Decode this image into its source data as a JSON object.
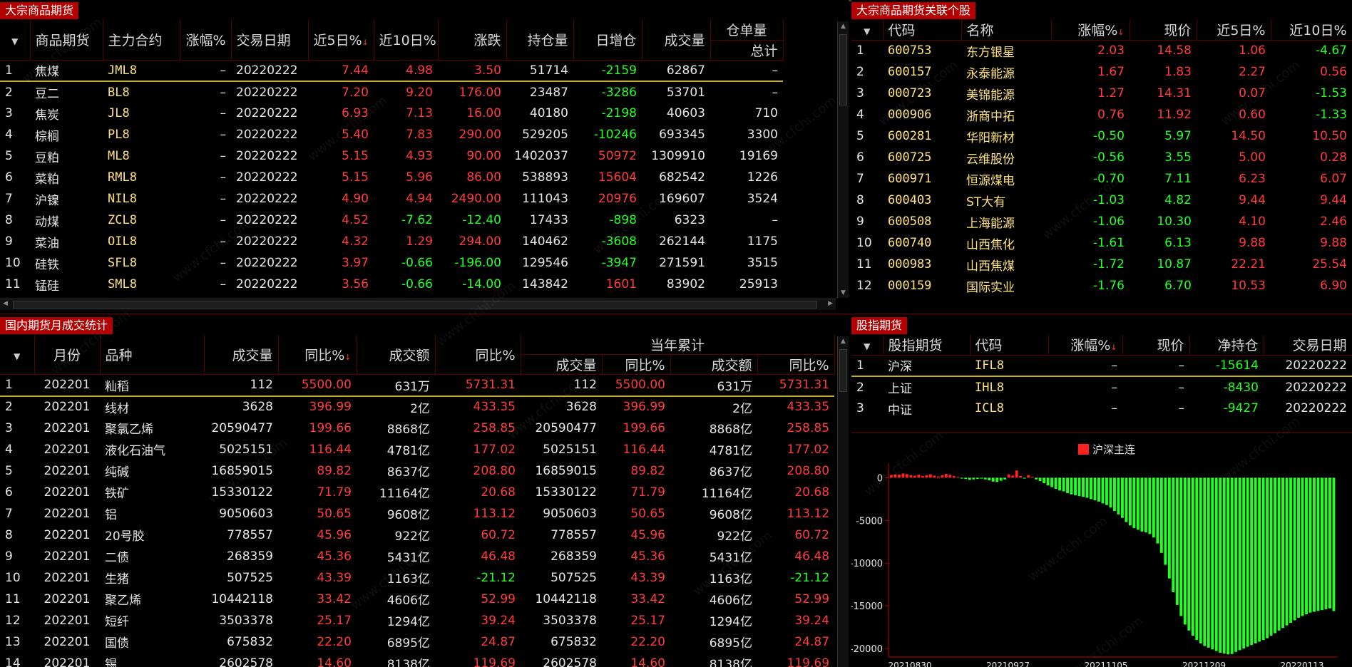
{
  "futures": {
    "title": "大宗商品期货",
    "columns": [
      "",
      "商品期货",
      "主力合约",
      "涨幅%",
      "交易日期",
      "近5日%",
      "近10日%",
      "涨跌",
      "持仓量",
      "日增仓",
      "成交量",
      "仓单量"
    ],
    "col_sub": "总计",
    "rows": [
      {
        "n": "1",
        "name": "焦煤",
        "code": "JML8",
        "chg": "–",
        "date": "20220222",
        "d5": "7.44",
        "d10": "4.98",
        "ud": "3.50",
        "oi": "51714",
        "inc": "-2159",
        "vol": "62867",
        "wr": "–"
      },
      {
        "n": "2",
        "name": "豆二",
        "code": "BL8",
        "chg": "–",
        "date": "20220222",
        "d5": "7.20",
        "d10": "9.20",
        "ud": "176.00",
        "oi": "23487",
        "inc": "-3286",
        "vol": "53701",
        "wr": "–"
      },
      {
        "n": "3",
        "name": "焦炭",
        "code": "JL8",
        "chg": "–",
        "date": "20220222",
        "d5": "6.93",
        "d10": "7.13",
        "ud": "16.00",
        "oi": "40180",
        "inc": "-2198",
        "vol": "40603",
        "wr": "710"
      },
      {
        "n": "4",
        "name": "棕榈",
        "code": "PL8",
        "chg": "–",
        "date": "20220222",
        "d5": "5.40",
        "d10": "7.83",
        "ud": "290.00",
        "oi": "529205",
        "inc": "-10246",
        "vol": "693345",
        "wr": "3300"
      },
      {
        "n": "5",
        "name": "豆粕",
        "code": "ML8",
        "chg": "–",
        "date": "20220222",
        "d5": "5.15",
        "d10": "4.93",
        "ud": "90.00",
        "oi": "1402037",
        "inc": "50972",
        "vol": "1309910",
        "wr": "19169"
      },
      {
        "n": "6",
        "name": "菜粕",
        "code": "RML8",
        "chg": "–",
        "date": "20220222",
        "d5": "5.15",
        "d10": "5.96",
        "ud": "86.00",
        "oi": "538893",
        "inc": "15604",
        "vol": "682542",
        "wr": "1226"
      },
      {
        "n": "7",
        "name": "沪镍",
        "code": "NIL8",
        "chg": "–",
        "date": "20220222",
        "d5": "4.90",
        "d10": "4.94",
        "ud": "2490.00",
        "oi": "111043",
        "inc": "20976",
        "vol": "169607",
        "wr": "3524"
      },
      {
        "n": "8",
        "name": "动煤",
        "code": "ZCL8",
        "chg": "–",
        "date": "20220222",
        "d5": "4.52",
        "d10": "-7.62",
        "ud": "-12.40",
        "oi": "17433",
        "inc": "-898",
        "vol": "6323",
        "wr": "–"
      },
      {
        "n": "9",
        "name": "菜油",
        "code": "OIL8",
        "chg": "–",
        "date": "20220222",
        "d5": "4.32",
        "d10": "1.29",
        "ud": "294.00",
        "oi": "140462",
        "inc": "-3608",
        "vol": "262144",
        "wr": "1175"
      },
      {
        "n": "10",
        "name": "硅铁",
        "code": "SFL8",
        "chg": "–",
        "date": "20220222",
        "d5": "3.97",
        "d10": "-0.66",
        "ud": "-196.00",
        "oi": "129546",
        "inc": "-3947",
        "vol": "271591",
        "wr": "3515"
      },
      {
        "n": "11",
        "name": "锰硅",
        "code": "SML8",
        "chg": "–",
        "date": "20220222",
        "d5": "3.56",
        "d10": "-0.66",
        "ud": "-14.00",
        "oi": "143842",
        "inc": "1601",
        "vol": "83902",
        "wr": "25913"
      }
    ]
  },
  "stocks": {
    "title": "大宗商品期货关联个股",
    "columns": [
      "",
      "代码",
      "名称",
      "涨幅%",
      "现价",
      "近5日%",
      "近10日%"
    ],
    "rows": [
      {
        "n": "1",
        "code": "600753",
        "name": "东方银星",
        "chg": "2.03",
        "price": "14.58",
        "d5": "1.06",
        "d10": "-4.67"
      },
      {
        "n": "2",
        "code": "600157",
        "name": "永泰能源",
        "chg": "1.67",
        "price": "1.83",
        "d5": "2.27",
        "d10": "0.56"
      },
      {
        "n": "3",
        "code": "000723",
        "name": "美锦能源",
        "chg": "1.27",
        "price": "14.31",
        "d5": "0.07",
        "d10": "-1.53"
      },
      {
        "n": "4",
        "code": "000906",
        "name": "浙商中拓",
        "chg": "0.76",
        "price": "11.92",
        "d5": "0.60",
        "d10": "-1.33"
      },
      {
        "n": "5",
        "code": "600281",
        "name": "华阳新材",
        "chg": "-0.50",
        "price": "5.97",
        "d5": "14.50",
        "d10": "10.50"
      },
      {
        "n": "6",
        "code": "600725",
        "name": "云维股份",
        "chg": "-0.56",
        "price": "3.55",
        "d5": "5.00",
        "d10": "0.28"
      },
      {
        "n": "7",
        "code": "600971",
        "name": "恒源煤电",
        "chg": "-0.70",
        "price": "7.11",
        "d5": "6.23",
        "d10": "6.07"
      },
      {
        "n": "8",
        "code": "600403",
        "name": "ST大有",
        "chg": "-1.03",
        "price": "4.82",
        "d5": "9.44",
        "d10": "9.44"
      },
      {
        "n": "9",
        "code": "600508",
        "name": "上海能源",
        "chg": "-1.06",
        "price": "10.30",
        "d5": "4.10",
        "d10": "2.46"
      },
      {
        "n": "10",
        "code": "600740",
        "name": "山西焦化",
        "chg": "-1.61",
        "price": "6.13",
        "d5": "9.88",
        "d10": "9.88"
      },
      {
        "n": "11",
        "code": "000983",
        "name": "山西焦煤",
        "chg": "-1.72",
        "price": "10.87",
        "d5": "22.21",
        "d10": "25.54"
      },
      {
        "n": "12",
        "code": "000159",
        "name": "国际实业",
        "chg": "-1.76",
        "price": "6.70",
        "d5": "10.53",
        "d10": "6.90"
      }
    ]
  },
  "monthly": {
    "title": "国内期货月成交统计",
    "columns": [
      "",
      "月份",
      "品种",
      "成交量",
      "同比%",
      "成交额",
      "同比%"
    ],
    "group_label": "当年累计",
    "group_columns": [
      "成交量",
      "同比%",
      "成交额",
      "同比%"
    ],
    "rows": [
      {
        "n": "1",
        "month": "202201",
        "name": "籼稻",
        "vol": "112",
        "yoy": "5500.00",
        "amt": "631万",
        "yoy2": "5731.31",
        "cvol": "112",
        "cyoy": "5500.00",
        "camt": "631万",
        "cyoy2": "5731.31"
      },
      {
        "n": "2",
        "month": "202201",
        "name": "线材",
        "vol": "3628",
        "yoy": "396.99",
        "amt": "2亿",
        "yoy2": "433.35",
        "cvol": "3628",
        "cyoy": "396.99",
        "camt": "2亿",
        "cyoy2": "433.35"
      },
      {
        "n": "3",
        "month": "202201",
        "name": "聚氯乙烯",
        "vol": "20590477",
        "yoy": "199.66",
        "amt": "8868亿",
        "yoy2": "258.85",
        "cvol": "20590477",
        "cyoy": "199.66",
        "camt": "8868亿",
        "cyoy2": "258.85"
      },
      {
        "n": "4",
        "month": "202201",
        "name": "液化石油气",
        "vol": "5025151",
        "yoy": "116.44",
        "amt": "4781亿",
        "yoy2": "177.02",
        "cvol": "5025151",
        "cyoy": "116.44",
        "camt": "4781亿",
        "cyoy2": "177.02"
      },
      {
        "n": "5",
        "month": "202201",
        "name": "纯碱",
        "vol": "16859015",
        "yoy": "89.82",
        "amt": "8637亿",
        "yoy2": "208.80",
        "cvol": "16859015",
        "cyoy": "89.82",
        "camt": "8637亿",
        "cyoy2": "208.80"
      },
      {
        "n": "6",
        "month": "202201",
        "name": "铁矿",
        "vol": "15330122",
        "yoy": "71.79",
        "amt": "11164亿",
        "yoy2": "20.68",
        "cvol": "15330122",
        "cyoy": "71.79",
        "camt": "11164亿",
        "cyoy2": "20.68"
      },
      {
        "n": "7",
        "month": "202201",
        "name": "铝",
        "vol": "9050603",
        "yoy": "50.65",
        "amt": "9608亿",
        "yoy2": "113.12",
        "cvol": "9050603",
        "cyoy": "50.65",
        "camt": "9608亿",
        "cyoy2": "113.12"
      },
      {
        "n": "8",
        "month": "202201",
        "name": "20号胶",
        "vol": "778557",
        "yoy": "45.96",
        "amt": "922亿",
        "yoy2": "60.72",
        "cvol": "778557",
        "cyoy": "45.96",
        "camt": "922亿",
        "cyoy2": "60.72"
      },
      {
        "n": "9",
        "month": "202201",
        "name": "二债",
        "vol": "268359",
        "yoy": "45.36",
        "amt": "5431亿",
        "yoy2": "46.48",
        "cvol": "268359",
        "cyoy": "45.36",
        "camt": "5431亿",
        "cyoy2": "46.48"
      },
      {
        "n": "10",
        "month": "202201",
        "name": "生猪",
        "vol": "507525",
        "yoy": "43.39",
        "amt": "1163亿",
        "yoy2": "-21.12",
        "cvol": "507525",
        "cyoy": "43.39",
        "camt": "1163亿",
        "cyoy2": "-21.12"
      },
      {
        "n": "11",
        "month": "202201",
        "name": "聚乙烯",
        "vol": "10442118",
        "yoy": "33.42",
        "amt": "4606亿",
        "yoy2": "52.99",
        "cvol": "10442118",
        "cyoy": "33.42",
        "camt": "4606亿",
        "cyoy2": "52.99"
      },
      {
        "n": "12",
        "month": "202201",
        "name": "短纤",
        "vol": "3503378",
        "yoy": "25.17",
        "amt": "1294亿",
        "yoy2": "39.24",
        "cvol": "3503378",
        "cyoy": "25.17",
        "camt": "1294亿",
        "cyoy2": "39.24"
      },
      {
        "n": "13",
        "month": "202201",
        "name": "国债",
        "vol": "675832",
        "yoy": "22.20",
        "amt": "6895亿",
        "yoy2": "24.87",
        "cvol": "675832",
        "cyoy": "22.20",
        "camt": "6895亿",
        "cyoy2": "24.87"
      },
      {
        "n": "14",
        "month": "202201",
        "name": "锡",
        "vol": "2602578",
        "yoy": "14.60",
        "amt": "8138亿",
        "yoy2": "119.69",
        "cvol": "2602578",
        "cyoy": "14.60",
        "camt": "8138亿",
        "cyoy2": "119.69"
      }
    ]
  },
  "index_futures": {
    "title": "股指期货",
    "columns": [
      "",
      "股指期货",
      "代码",
      "涨幅%",
      "现价",
      "净持仓",
      "交易日期"
    ],
    "rows": [
      {
        "n": "1",
        "name": "沪深",
        "code": "IFL8",
        "chg": "–",
        "price": "–",
        "net": "-15614",
        "date": "20220222"
      },
      {
        "n": "2",
        "name": "上证",
        "code": "IHL8",
        "chg": "–",
        "price": "–",
        "net": "-8430",
        "date": "20220222"
      },
      {
        "n": "3",
        "name": "中证",
        "code": "ICL8",
        "chg": "–",
        "price": "–",
        "net": "-9427",
        "date": "20220222"
      }
    ]
  },
  "watermark": "www.cfchi.com",
  "chart_data": {
    "type": "bar",
    "legend": [
      "沪深主连"
    ],
    "legend_placement": "top-center",
    "colors": {
      "positive": "#ff2020",
      "negative": "#22ff22"
    },
    "yticks": [
      0,
      -5000,
      -10000,
      -15000,
      -20000
    ],
    "ylim": [
      -21000,
      1200
    ],
    "xtick_labels": [
      "20210830",
      "20210927",
      "20211105",
      "20211209",
      "20220113"
    ],
    "values": [
      300,
      400,
      350,
      500,
      420,
      300,
      250,
      350,
      200,
      300,
      400,
      250,
      150,
      300,
      450,
      350,
      200,
      100,
      -100,
      -150,
      -250,
      -200,
      -150,
      -100,
      -200,
      -300,
      -450,
      -500,
      -350,
      -200,
      400,
      250,
      850,
      200,
      -100,
      300,
      100,
      -200,
      -400,
      -650,
      -900,
      -1100,
      -1300,
      -1500,
      -1600,
      -1800,
      -1950,
      -2050,
      -2150,
      -2250,
      -2350,
      -2500,
      -2650,
      -2800,
      -3000,
      -3200,
      -3500,
      -3900,
      -4300,
      -4700,
      -5200,
      -5600,
      -5900,
      -6100,
      -6300,
      -6400,
      -6600,
      -7000,
      -7700,
      -8800,
      -10200,
      -11800,
      -13400,
      -14900,
      -16200,
      -17200,
      -17900,
      -18500,
      -19000,
      -19400,
      -19700,
      -19900,
      -20100,
      -20300,
      -20500,
      -20600,
      -20700,
      -20650,
      -20400,
      -20200,
      -20000,
      -19800,
      -19600,
      -19400,
      -19200,
      -19000,
      -18800,
      -18500,
      -18200,
      -17900,
      -17600,
      -17300,
      -17000,
      -16700,
      -16400,
      -16200,
      -16000,
      -15800,
      -15700,
      -15600,
      -15500,
      -15400,
      -15300,
      -15614
    ]
  }
}
